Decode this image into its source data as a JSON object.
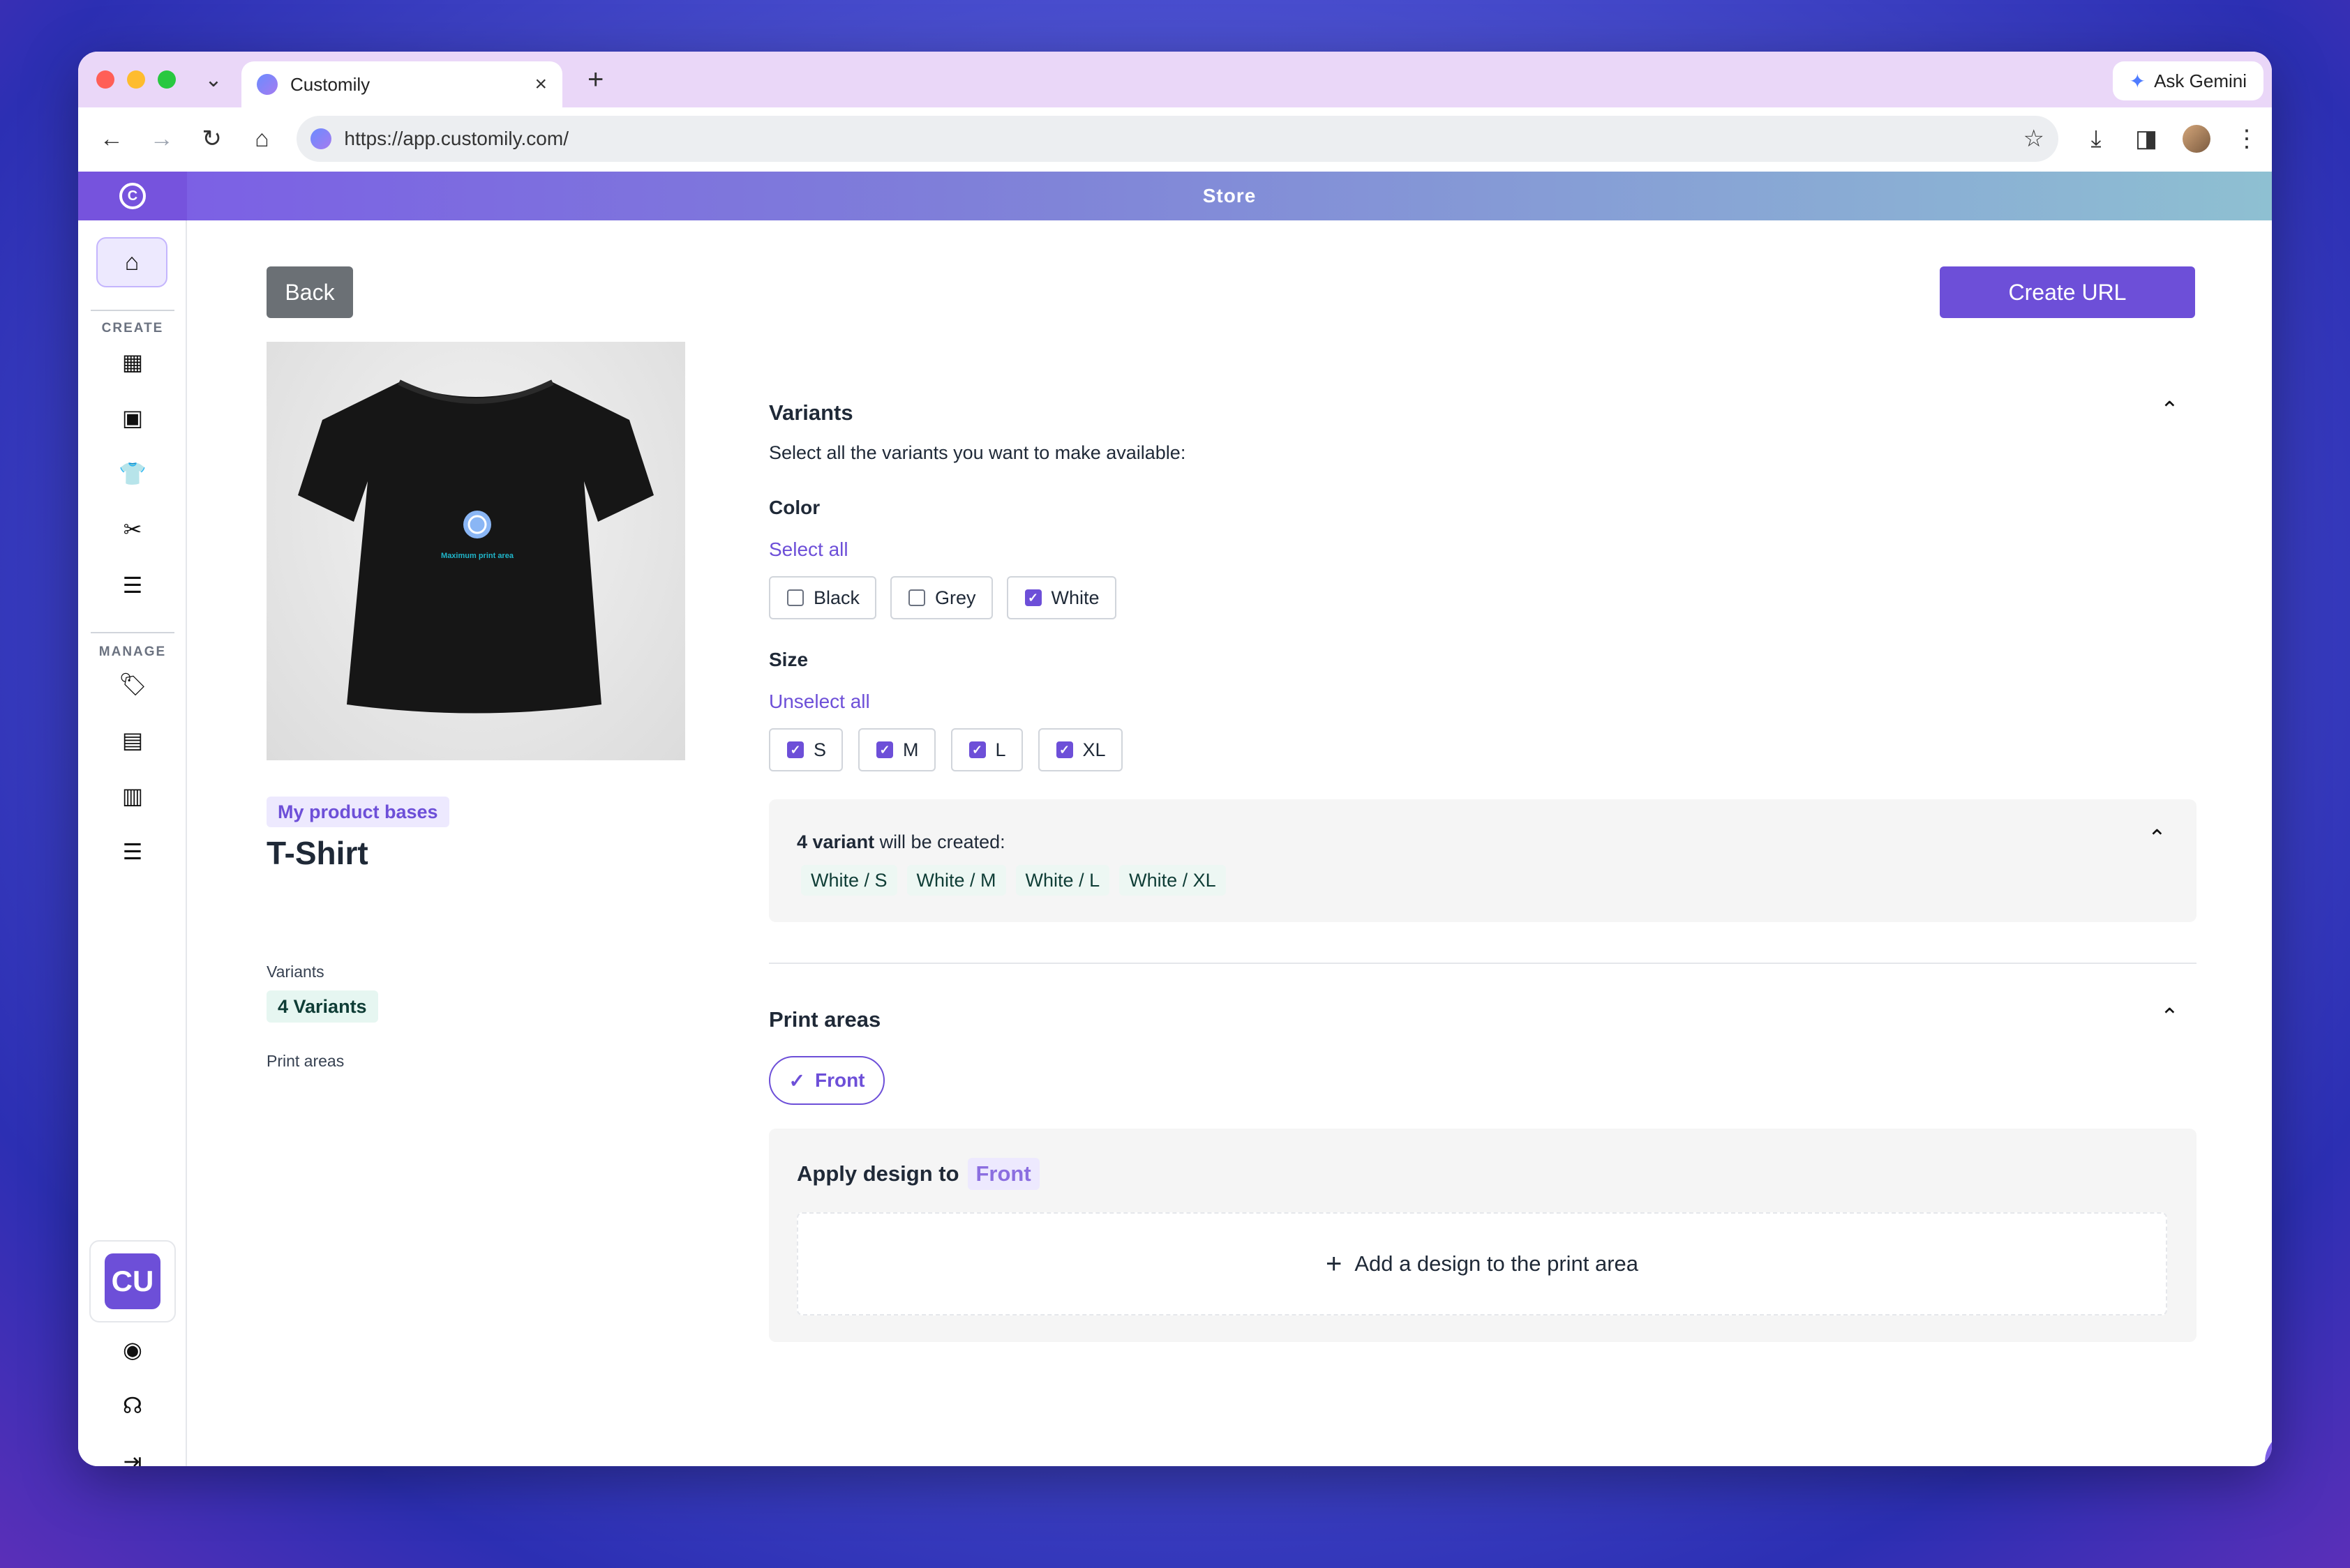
{
  "browser": {
    "tab_title": "Customily",
    "url": "https://app.customily.com/",
    "ask_gemini": "Ask Gemini"
  },
  "app": {
    "header_title": "Store",
    "logo_letter": "C"
  },
  "sidebar": {
    "section_create": "CREATE",
    "section_manage": "MANAGE",
    "avatar_initials": "CU"
  },
  "toolbar": {
    "back_label": "Back",
    "create_url_label": "Create URL"
  },
  "product": {
    "badge": "My product bases",
    "title": "T-Shirt",
    "variants_label": "Variants",
    "variants_count": "4 Variants",
    "print_areas_label": "Print areas",
    "shirt_text": "Maximum print area"
  },
  "variants": {
    "title": "Variants",
    "description": "Select all the variants you want to make available:",
    "color_title": "Color",
    "color_toggle": "Select all",
    "colors": [
      {
        "label": "Black",
        "checked": false
      },
      {
        "label": "Grey",
        "checked": false
      },
      {
        "label": "White",
        "checked": true
      }
    ],
    "size_title": "Size",
    "size_toggle": "Unselect all",
    "sizes": [
      {
        "label": "S",
        "checked": true
      },
      {
        "label": "M",
        "checked": true
      },
      {
        "label": "L",
        "checked": true
      },
      {
        "label": "XL",
        "checked": true
      }
    ],
    "summary_bold": "4 variant",
    "summary_rest": " will be created:",
    "created": [
      "White / S",
      "White / M",
      "White / L",
      "White / XL"
    ]
  },
  "print_areas": {
    "title": "Print areas",
    "selected": "Front",
    "apply_label": "Apply design to",
    "apply_target": "Front",
    "add_design": "Add a design to the print area"
  },
  "colors": {
    "accent": "#6d4fd8",
    "back_button": "#6b7075"
  }
}
